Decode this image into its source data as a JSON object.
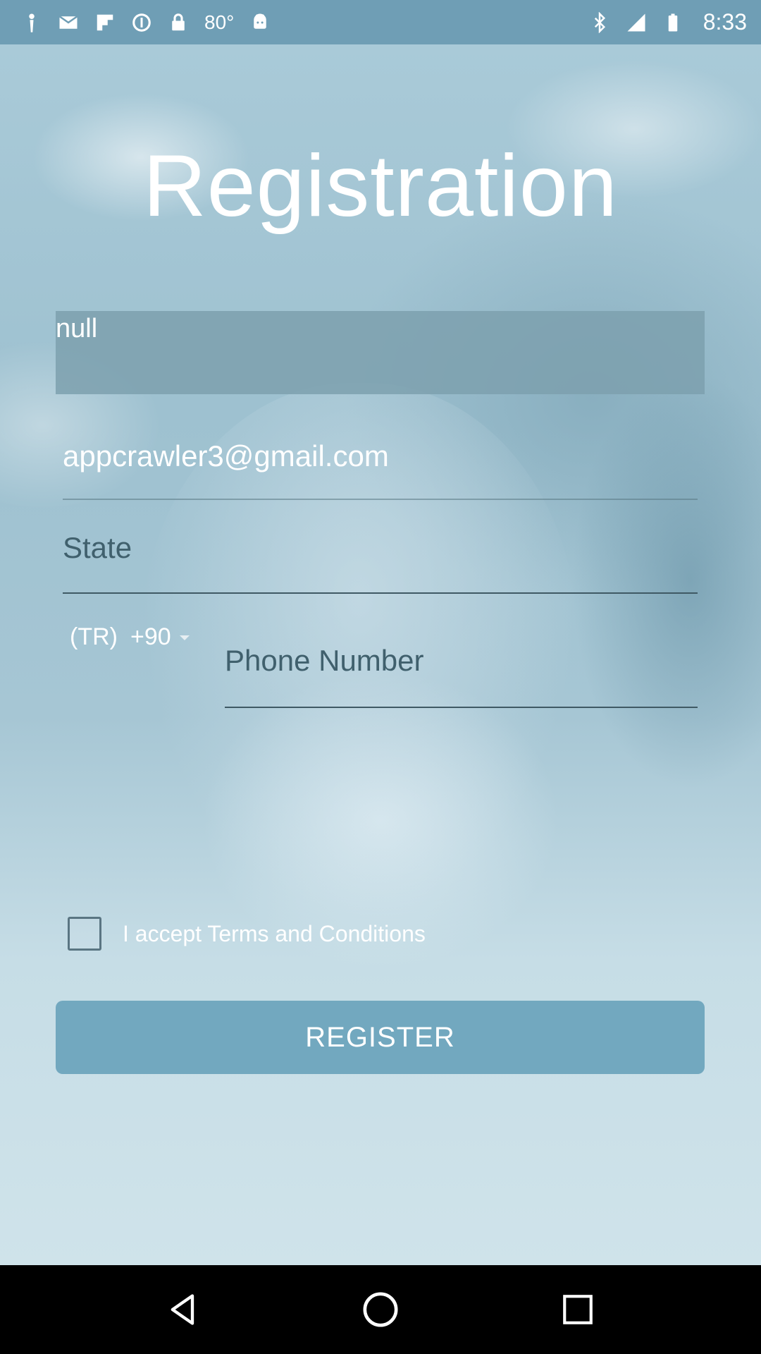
{
  "status_bar": {
    "left_icons": [
      "person-pin-icon",
      "mail-icon",
      "flipboard-icon",
      "info-circle-icon",
      "lock-icon"
    ],
    "temperature": "80°",
    "android_icon": "android-icon",
    "right_icons": [
      "bluetooth-icon",
      "signal-icon",
      "battery-icon"
    ],
    "time": "8:33"
  },
  "form": {
    "title": "Registration",
    "name_value": "null",
    "email_value": "appcrawler3@gmail.com",
    "state_placeholder": "State",
    "country_code": "(TR)",
    "dial_code": "+90",
    "phone_placeholder": "Phone Number",
    "terms_label": "I accept Terms and Conditions",
    "terms_checked": false,
    "register_label": "REGISTER"
  },
  "colors": {
    "status_bar": "#6f9eb5",
    "register_button": "#72a8bf",
    "name_field_bg": "#7da0ae"
  },
  "nav_bar": {
    "buttons": [
      "back-icon",
      "home-icon",
      "recents-icon"
    ]
  }
}
